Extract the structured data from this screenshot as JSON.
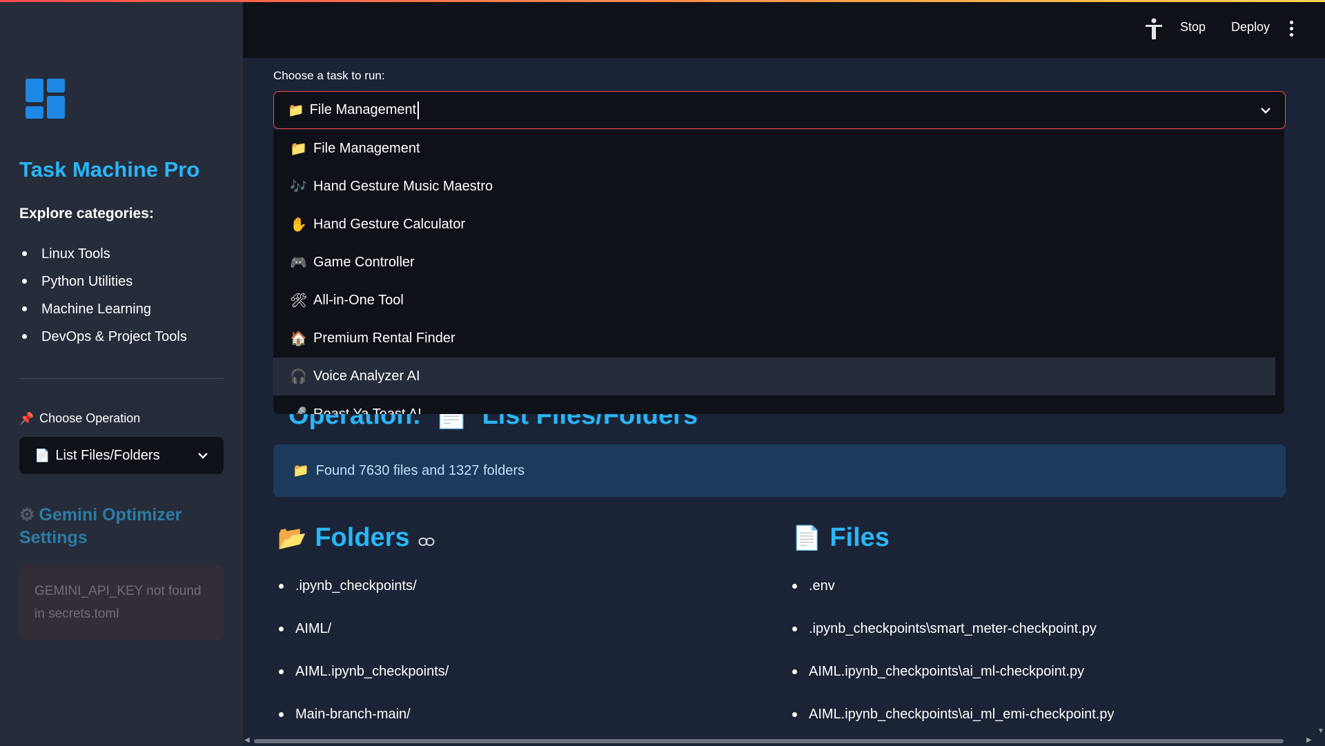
{
  "colors": {
    "accent": "#29b6f6",
    "primary_red": "#ff4b4b",
    "sidebar_bg": "#262c3a",
    "main_bg": "#1b2336",
    "info_bg": "#1c3b5c"
  },
  "header": {
    "stop_label": "Stop",
    "deploy_label": "Deploy",
    "accessibility_icon": "person-icon",
    "menu_icon": "kebab-icon"
  },
  "sidebar": {
    "title": "Task Machine Pro",
    "explore_label": "Explore categories:",
    "categories": [
      "Linux Tools",
      "Python Utilities",
      "Machine Learning",
      "DevOps & Project Tools"
    ],
    "choose_operation_label": "Choose Operation",
    "choose_operation_icon": "📌",
    "operation_select": {
      "icon": "📄",
      "value": "List Files/Folders"
    },
    "gemini_heading": "Gemini Optimizer Settings",
    "gemini_icon": "⚙",
    "gemini_warning": "GEMINI_API_KEY not found in secrets.toml"
  },
  "main": {
    "task_label": "Choose a task to run:",
    "task_select": {
      "icon": "📁",
      "value": "File Management"
    },
    "dropdown_options": [
      {
        "icon": "📁",
        "label": "File Management"
      },
      {
        "icon": "🎶",
        "label": "Hand Gesture Music Maestro"
      },
      {
        "icon": "✋",
        "label": "Hand Gesture Calculator"
      },
      {
        "icon": "🎮",
        "label": "Game Controller"
      },
      {
        "icon": "🛠",
        "label": "All-in-One Tool"
      },
      {
        "icon": "🏠",
        "label": "Premium Rental Finder"
      },
      {
        "icon": "🎧",
        "label": "Voice Analyzer AI"
      },
      {
        "icon": "🎤",
        "label": "Roast Ya Toast AI"
      }
    ],
    "highlighted_option": 6,
    "operation_heading_prefix": "Operation:",
    "operation_heading_icon": "📄",
    "operation_heading_value": "List Files/Folders",
    "found_icon": "📁",
    "found_text": "Found 7630 files and 1327 folders",
    "folders_heading": "Folders",
    "folders_icon": "📂",
    "files_heading": "Files",
    "files_icon": "📄",
    "folders": [
      ".ipynb_checkpoints/",
      "AIML/",
      "AIML.ipynb_checkpoints/",
      "Main-branch-main/"
    ],
    "files": [
      ".env",
      ".ipynb_checkpoints\\smart_meter-checkpoint.py",
      "AIML.ipynb_checkpoints\\ai_ml-checkpoint.py",
      "AIML.ipynb_checkpoints\\ai_ml_emi-checkpoint.py"
    ]
  }
}
